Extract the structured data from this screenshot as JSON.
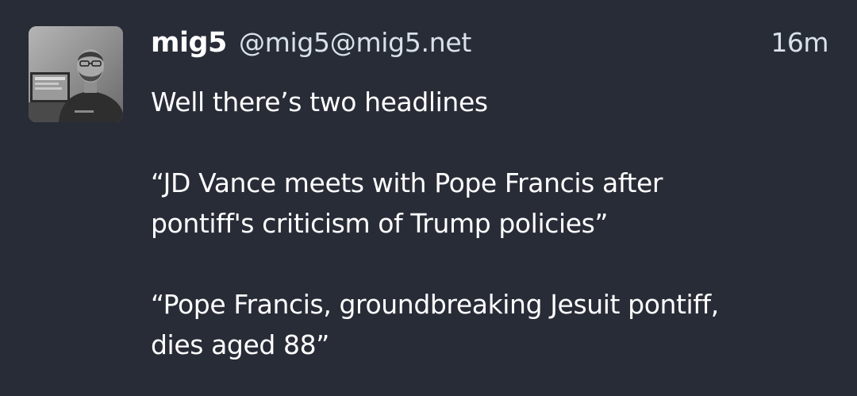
{
  "post": {
    "author": {
      "display_name": "mig5",
      "handle": "@mig5@mig5.net",
      "avatar_icon": "user-avatar-photo"
    },
    "timestamp": "16m",
    "paragraphs": [
      {
        "lines": [
          "Well there’s two headlines"
        ]
      },
      {
        "lines": [
          "“JD Vance meets with Pope Francis after",
          "pontiff's criticism of Trump policies”"
        ]
      },
      {
        "lines": [
          "“Pope Francis, groundbreaking Jesuit pontiff,",
          "dies aged 88”"
        ]
      }
    ]
  },
  "colors": {
    "background": "#282c37",
    "text_primary": "#ffffff",
    "text_secondary": "#d9e1e8"
  }
}
